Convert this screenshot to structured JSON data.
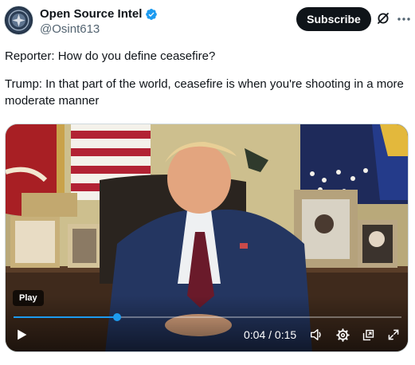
{
  "account": {
    "display_name": "Open Source Intel",
    "handle": "@Osint613",
    "verified": true
  },
  "header": {
    "subscribe_label": "Subscribe"
  },
  "tweet": {
    "lines": [
      "Reporter: How do you define ceasefire?",
      "Trump: In that part of the world, ceasefire is when you're shooting in a more moderate manner"
    ]
  },
  "video": {
    "play_badge": "Play",
    "time_display": "0:04 / 0:15",
    "progress": 0.267
  },
  "colors": {
    "accent": "#1d9bf0",
    "subscribe_bg": "#0f1419",
    "text_primary": "#0f1419",
    "text_secondary": "#536471"
  },
  "icons": {
    "verified": "verified-badge-icon",
    "grok": "grok-icon",
    "more": "more-icon",
    "play": "play-icon",
    "volume": "volume-icon",
    "settings": "settings-icon",
    "pip": "picture-in-picture-icon",
    "fullscreen": "fullscreen-icon"
  }
}
